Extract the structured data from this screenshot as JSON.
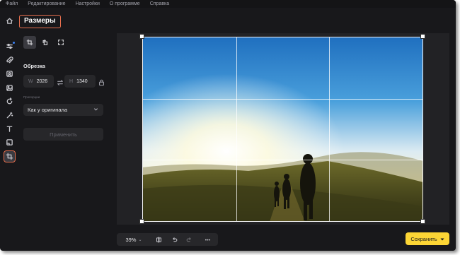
{
  "menu": [
    "Файл",
    "Редактирование",
    "Настройки",
    "О программе",
    "Справка"
  ],
  "sidebar": {
    "icons": [
      "home-icon",
      "adjustments-icon",
      "paperclip-icon",
      "portrait-icon",
      "photo-icon",
      "rotate-icon",
      "magic-wand-icon",
      "text-icon",
      "frame-icon",
      "crop-icon"
    ],
    "active": "crop-icon"
  },
  "panel": {
    "title": "Размеры",
    "section": "Обрезка",
    "width_label": "W",
    "width_value": "2026",
    "height_label": "H",
    "height_value": "1340",
    "ratio_label": "Пропорции",
    "ratio_value": "Как у оригинала",
    "apply": "Применить"
  },
  "toolbar": {
    "zoom": "39%"
  },
  "save_button": "Сохранить",
  "colors": {
    "accent": "#fcd535",
    "highlight": "#e8704f",
    "background": "#18181b"
  }
}
